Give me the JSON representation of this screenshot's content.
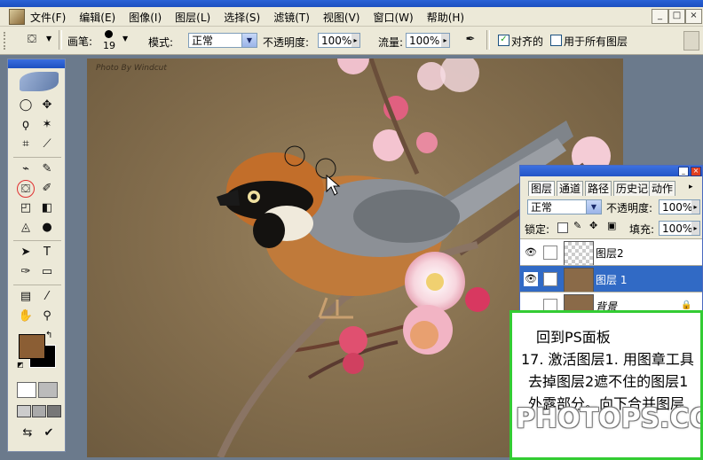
{
  "menu": [
    "文件(F)",
    "编辑(E)",
    "图像(I)",
    "图层(L)",
    "选择(S)",
    "滤镜(T)",
    "视图(V)",
    "窗口(W)",
    "帮助(H)"
  ],
  "window_buttons": {
    "minimize": "_",
    "restore": "□",
    "close": "×"
  },
  "options": {
    "brush_label": "画笔:",
    "brush_size": "19",
    "mode_label": "模式:",
    "mode_value": "正常",
    "opacity_label": "不透明度:",
    "opacity_value": "100%",
    "flow_label": "流量:",
    "flow_value": "100%",
    "aligned_label": "对齐的",
    "aligned_checked": true,
    "all_layers_label": "用于所有图层",
    "all_layers_checked": false
  },
  "canvas": {
    "watermark": "Photo By Windcut"
  },
  "layers_panel": {
    "tabs": [
      "图层",
      "通道",
      "路径",
      "历史记录",
      "动作"
    ],
    "blend_mode": "正常",
    "opacity_label": "不透明度:",
    "opacity_value": "100%",
    "lock_label": "锁定:",
    "fill_label": "填充:",
    "fill_value": "100%",
    "layers": [
      {
        "name": "图层2",
        "visible": true,
        "selected": false
      },
      {
        "name": "图层 1",
        "visible": true,
        "selected": true
      },
      {
        "name": "背景",
        "visible": false,
        "selected": false
      }
    ]
  },
  "tutorial": {
    "line1": "回到PS面板",
    "line2": "17. 激活图层1. 用图章工具",
    "line3": "去掉图层2遮不住的图层1",
    "line4": "外露部分。向下合并图层",
    "watermark": "PHOTOPS.COM"
  },
  "colors": {
    "foreground": "#8b5e34",
    "background": "#000000",
    "accent": "#316ac5",
    "overlay_border": "#33cc33"
  }
}
